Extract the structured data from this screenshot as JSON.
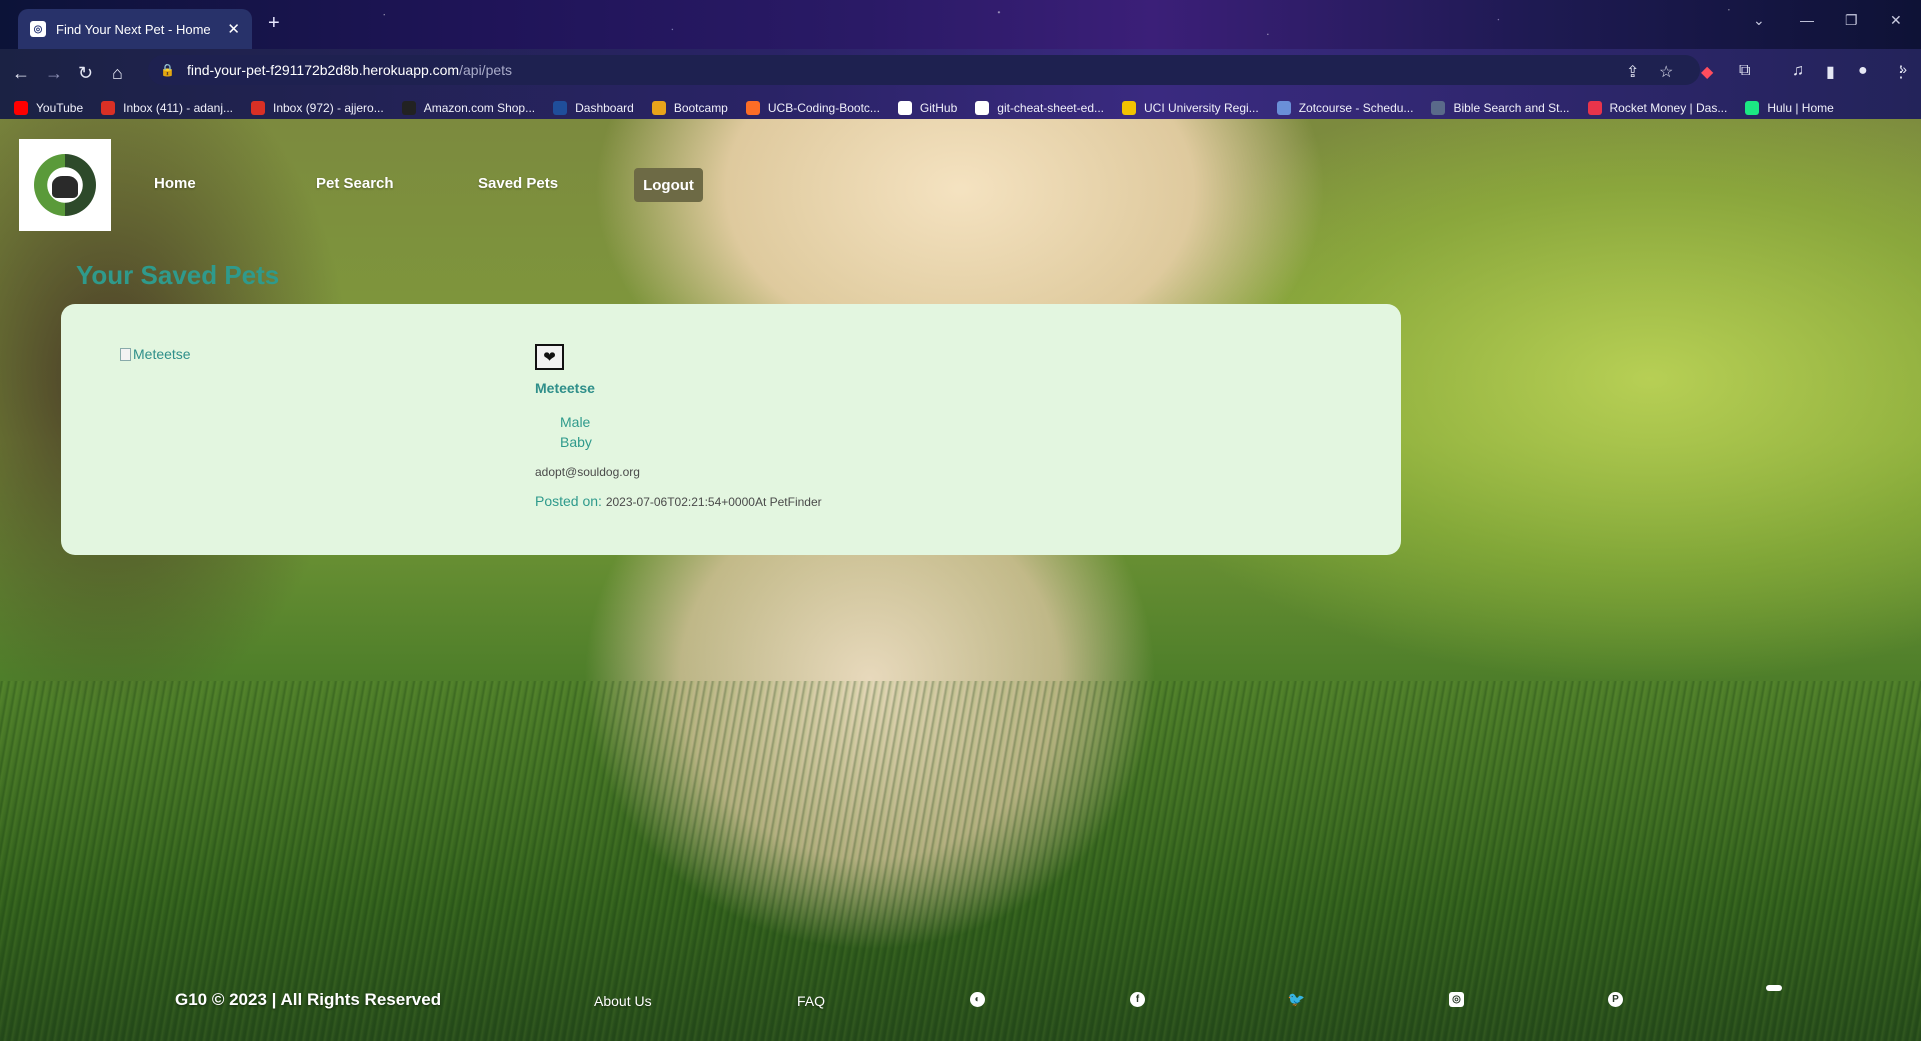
{
  "browser": {
    "tab_title": "Find Your Next Pet - Home",
    "tab_close": "✕",
    "new_tab": "+",
    "url_host": "find-your-pet-f291172b2d8b.herokuapp.com",
    "url_path": "/api/pets",
    "bookmarks": [
      {
        "label": "YouTube",
        "icon": "youtube-icon",
        "color": "#ff0000"
      },
      {
        "label": "Inbox (411) - adanj...",
        "icon": "gmail-icon",
        "color": "#d93025"
      },
      {
        "label": "Inbox (972) - ajjero...",
        "icon": "gmail-icon",
        "color": "#d93025"
      },
      {
        "label": "Amazon.com Shop...",
        "icon": "amazon-icon",
        "color": "#222222"
      },
      {
        "label": "Dashboard",
        "icon": "uci-icon",
        "color": "#1f4e9a"
      },
      {
        "label": "Bootcamp",
        "icon": "bootcamp-icon",
        "color": "#e8a41b"
      },
      {
        "label": "UCB-Coding-Bootc...",
        "icon": "gitlab-icon",
        "color": "#fc6d26"
      },
      {
        "label": "GitHub",
        "icon": "github-icon",
        "color": "#ffffff"
      },
      {
        "label": "git-cheat-sheet-ed...",
        "icon": "github-icon",
        "color": "#ffffff"
      },
      {
        "label": "UCI University Regi...",
        "icon": "uci-icon",
        "color": "#f2c200"
      },
      {
        "label": "Zotcourse - Schedu...",
        "icon": "calendar-icon",
        "color": "#6a8fd8"
      },
      {
        "label": "Bible Search and St...",
        "icon": "bible-icon",
        "color": "#5a6a8a"
      },
      {
        "label": "Rocket Money | Das...",
        "icon": "rocket-icon",
        "color": "#e8344b"
      },
      {
        "label": "Hulu | Home",
        "icon": "hulu-icon",
        "color": "#1ce783"
      }
    ]
  },
  "nav": {
    "home": "Home",
    "pet_search": "Pet Search",
    "saved_pets": "Saved Pets",
    "logout": "Logout"
  },
  "page": {
    "title": "Your Saved Pets"
  },
  "pet": {
    "image_alt": "Meteetse",
    "name": "Meteetse",
    "gender": "Male",
    "age": "Baby",
    "email": "adopt@souldog.org",
    "posted_label": "Posted on:",
    "posted_value": "2023-07-06T02:21:54+0000At PetFinder"
  },
  "footer": {
    "copyright": "G10 © 2023 | All Rights Reserved",
    "about": "About Us",
    "faq": "FAQ"
  }
}
